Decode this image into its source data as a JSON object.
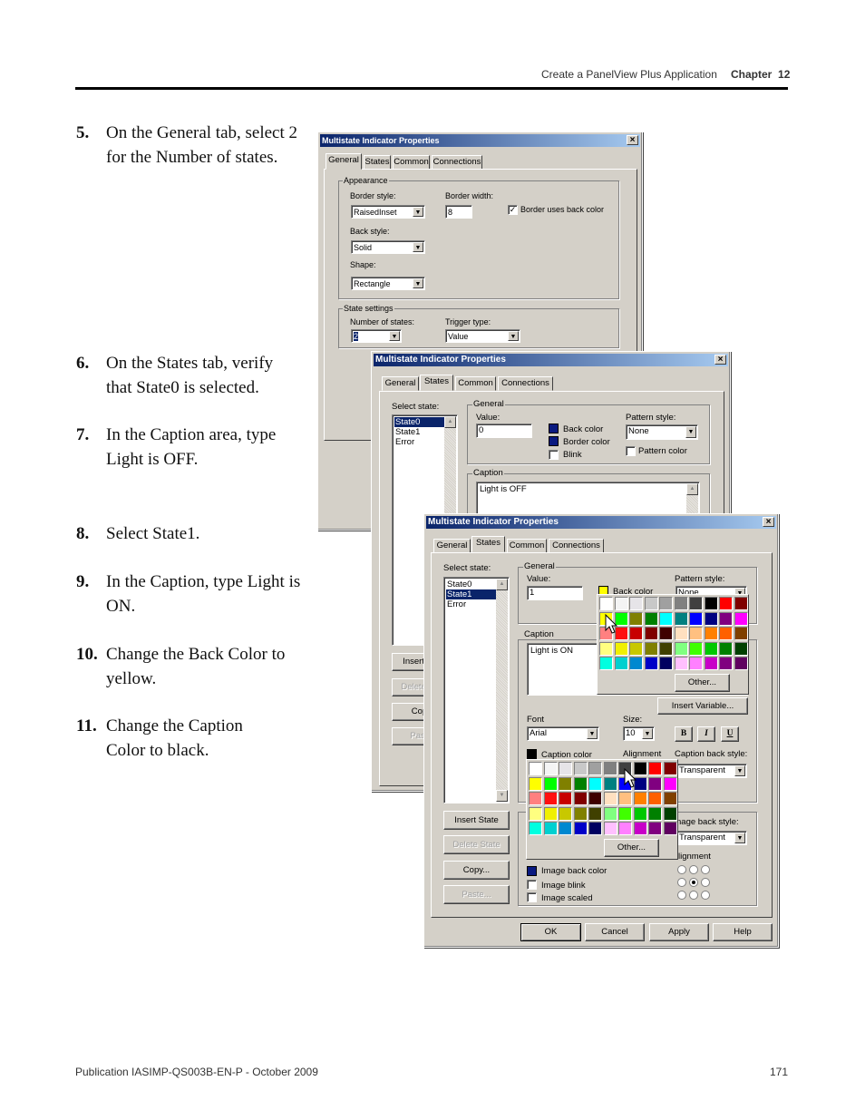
{
  "header": {
    "section": "Create a PanelView Plus Application",
    "chapter_label": "Chapter",
    "chapter_number": "12"
  },
  "steps": [
    {
      "num": "5.",
      "text": "On the General tab, select 2 for the Number of states."
    },
    {
      "num": "6.",
      "text": "On the States tab, verify that State0 is selected."
    },
    {
      "num": "7.",
      "text": "In the Caption area, type Light is OFF."
    },
    {
      "num": "8.",
      "text": "Select State1."
    },
    {
      "num": "9.",
      "text": "In the Caption, type Light is ON."
    },
    {
      "num": "10.",
      "text": "Change the Back Color to yellow."
    },
    {
      "num": "11.",
      "text": "Change the Caption Color to black."
    }
  ],
  "footer": {
    "publication": "Publication IASIMP-QS003B-EN-P - October 2009",
    "page": "171"
  },
  "dialog_title": "Multistate Indicator Properties",
  "tabs": [
    "General",
    "States",
    "Common",
    "Connections"
  ],
  "general_tab": {
    "appearance": "Appearance",
    "border_style_label": "Border style:",
    "border_style": "RaisedInset",
    "border_width_label": "Border width:",
    "border_width": "8",
    "border_uses_back_color": "Border uses back color",
    "back_style_label": "Back style:",
    "back_style": "Solid",
    "shape_label": "Shape:",
    "shape": "Rectangle",
    "state_settings": "State settings",
    "num_states_label": "Number of states:",
    "num_states": "2",
    "trigger_type_label": "Trigger type:",
    "trigger_type": "Value"
  },
  "states_tab": {
    "select_state": "Select state:",
    "states": [
      "State0",
      "State1",
      "Error"
    ],
    "general": "General",
    "value_label": "Value:",
    "back_color": "Back color",
    "border_color": "Border color",
    "blink": "Blink",
    "pattern_style_label": "Pattern style:",
    "pattern_style": "None",
    "pattern_color": "Pattern color",
    "caption": "Caption",
    "insert_variable": "Insert Variable...",
    "font_label": "Font",
    "font": "Arial",
    "size_label": "Size:",
    "size": "10",
    "bold": "B",
    "italic": "I",
    "underline": "U",
    "caption_color": "Caption color",
    "alignment": "Alignment",
    "caption_back_style_label": "Caption back style:",
    "caption_back_style": "Transparent",
    "image_back_style_label": "nage back style:",
    "image_back_style": "Transparent",
    "image_alignment": "lignment",
    "image_back_color": "Image back color",
    "image_blink": "Image blink",
    "image_scaled": "Image scaled",
    "insert_state": "Insert State",
    "delete_state": "Delete State",
    "copy": "Copy...",
    "paste": "Paste...",
    "other": "Other..."
  },
  "dialog2": {
    "value": "0",
    "caption_text": "Light is OFF",
    "back_color": "#0a1a80",
    "border_color": "#0a1a80"
  },
  "dialog3": {
    "value": "1",
    "caption_text": "Light is ON",
    "back_color": "#ffff00",
    "caption_color": "#000000",
    "image_back_color": "#0a1a80"
  },
  "buttons": {
    "ok": "OK",
    "cancel": "Cancel",
    "apply": "Apply",
    "help": "Help"
  },
  "palette": [
    [
      "#ffffff",
      "#f4f4f4",
      "#e6e4e8",
      "#c8c8c8",
      "#a0a0a0",
      "#808080",
      "#404040",
      "#000000",
      "#ff0000",
      "#800000"
    ],
    [
      "#ffff00",
      "#00ff00",
      "#808000",
      "#008000",
      "#00ffff",
      "#008080",
      "#0000ff",
      "#000080",
      "#800080",
      "#ff00ff"
    ],
    [
      "#ff8080",
      "#ff1010",
      "#c80000",
      "#800000",
      "#400000",
      "#ffe0c0",
      "#ffc080",
      "#ff8000",
      "#ff6000",
      "#804000"
    ],
    [
      "#ffff80",
      "#f0f000",
      "#c8c800",
      "#808000",
      "#404000",
      "#80ff80",
      "#40ff00",
      "#00c800",
      "#008000",
      "#004000"
    ],
    [
      "#00ffe0",
      "#00d0d0",
      "#0088d0",
      "#0000c8",
      "#000060",
      "#ffc0ff",
      "#ff80ff",
      "#c800c8",
      "#800080",
      "#600060"
    ]
  ]
}
